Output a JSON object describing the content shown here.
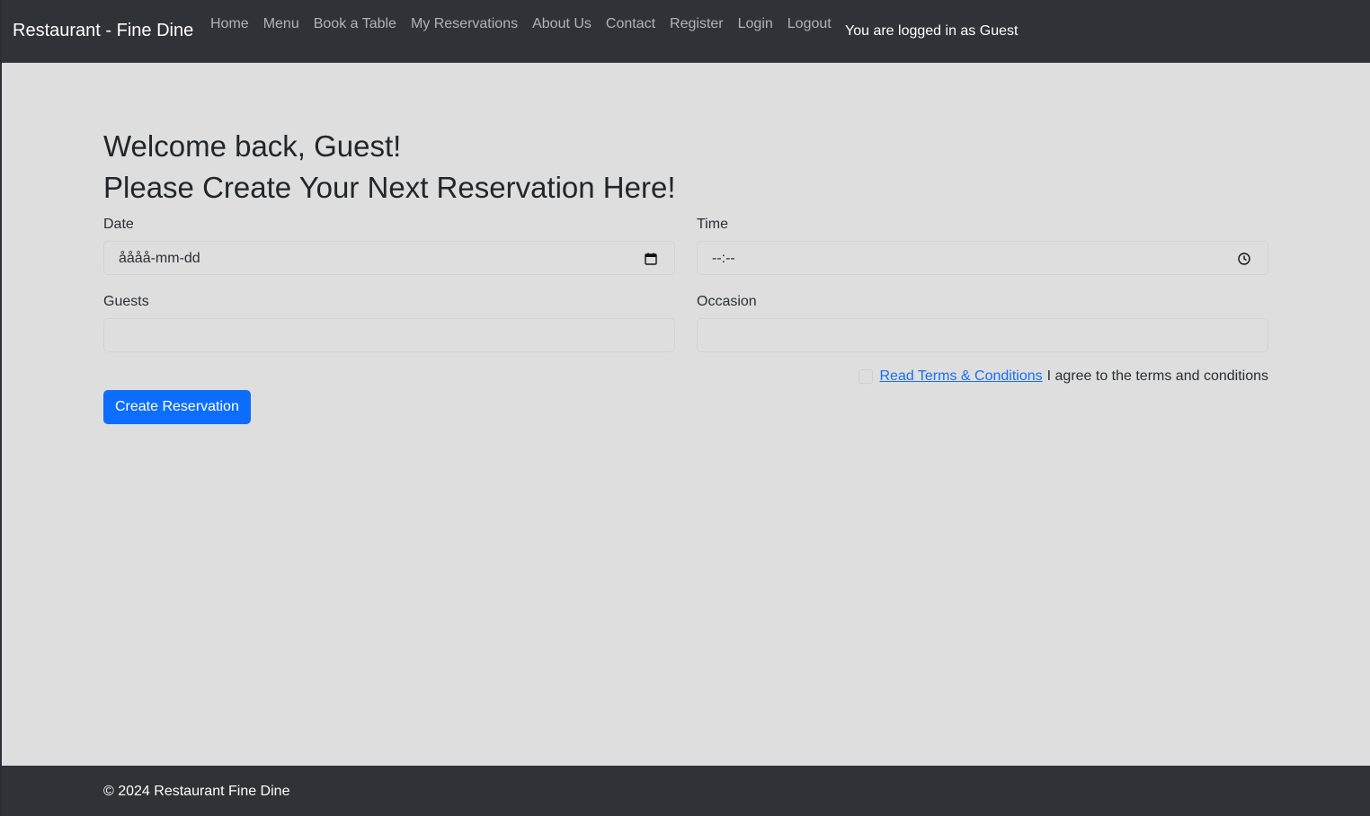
{
  "navbar": {
    "brand": "Restaurant - Fine Dine",
    "links": [
      "Home",
      "Menu",
      "Book a Table",
      "My Reservations",
      "About Us",
      "Contact",
      "Register",
      "Login",
      "Logout"
    ],
    "status": "You are logged in as Guest"
  },
  "main": {
    "welcome": "Welcome back, Guest!",
    "subheading": "Please Create Your Next Reservation Here!",
    "date": {
      "label": "Date",
      "value": "åååå-mm-dd",
      "icon": "calendar-icon"
    },
    "time": {
      "label": "Time",
      "value": "--:--",
      "icon": "clock-icon"
    },
    "guests": {
      "label": "Guests",
      "value": ""
    },
    "occasion": {
      "label": "Occasion",
      "value": ""
    },
    "terms_link": "Read Terms & Conditions",
    "terms_text": "I agree to the terms and conditions",
    "submit_label": "Create Reservation"
  },
  "footer": {
    "text": "© 2024 Restaurant Fine Dine"
  },
  "colors": {
    "navbar_bg": "#2f3237",
    "page_bg": "#dedede",
    "primary_button": "#0d6efd",
    "link": "#1a6ef5"
  }
}
